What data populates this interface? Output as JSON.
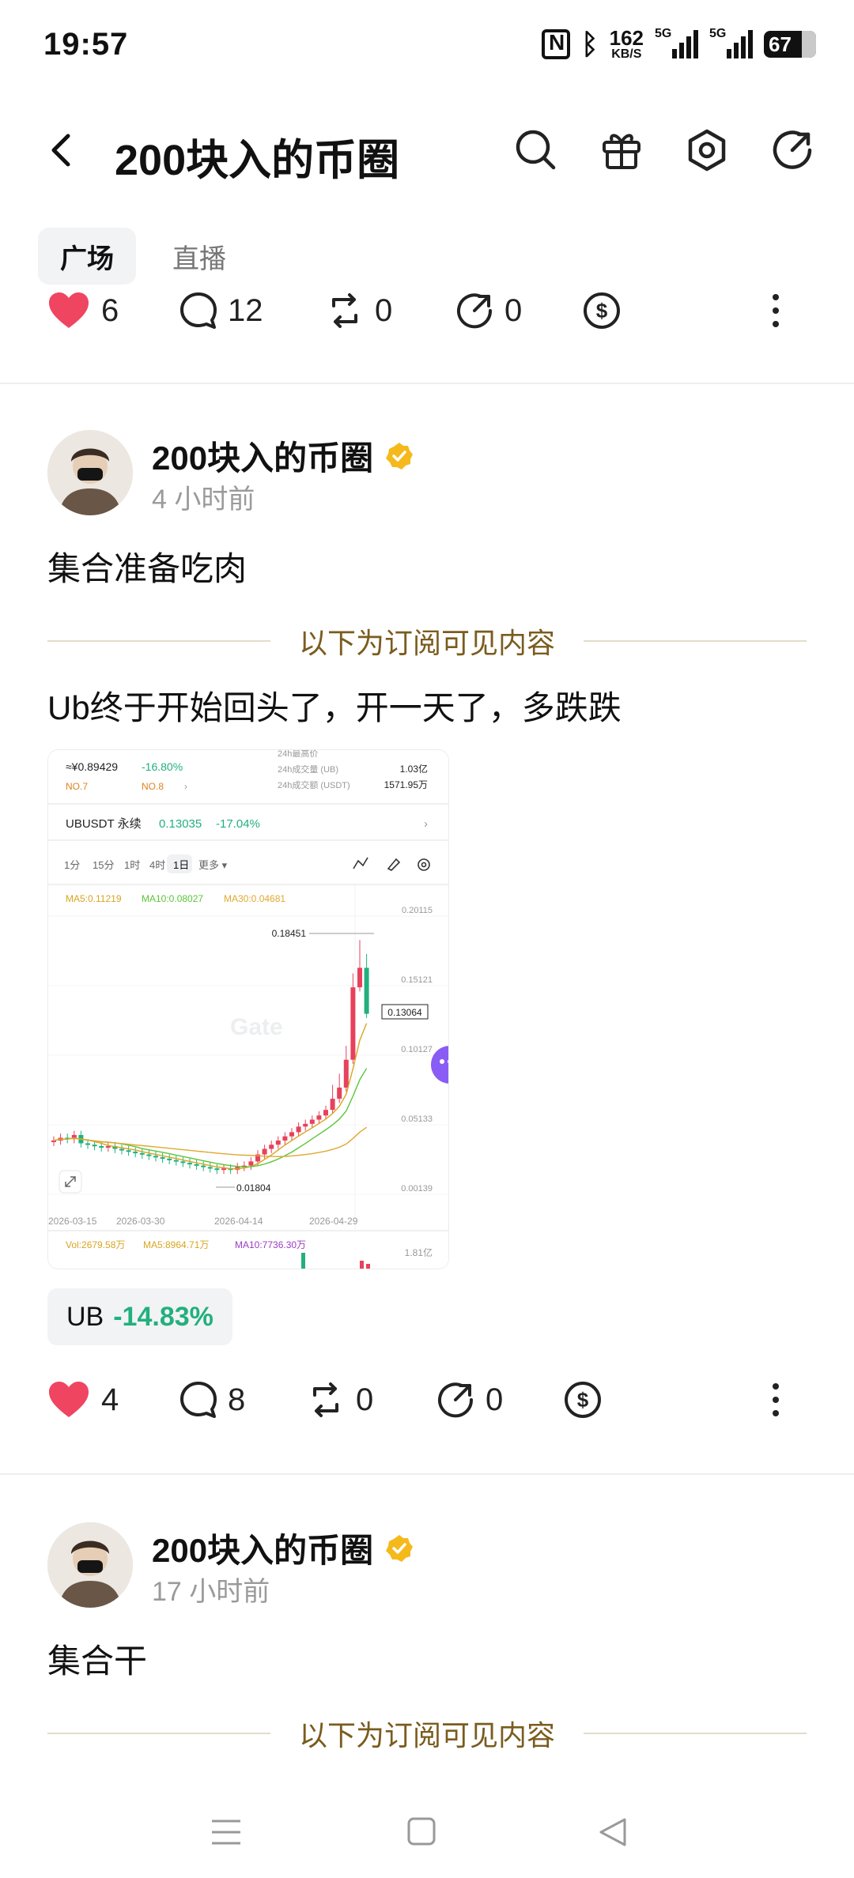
{
  "status": {
    "time": "19:57",
    "speed_value": "162",
    "speed_unit": "KB/S",
    "signal1": "5G",
    "signal2": "5G",
    "battery": "67"
  },
  "header": {
    "title": "200块入的币圈"
  },
  "tabs": [
    {
      "label": "广场"
    },
    {
      "label": "直播"
    }
  ],
  "top_actions": {
    "likes": "6",
    "comments": "12",
    "reposts": "0",
    "shares": "0"
  },
  "posts": [
    {
      "author": "200块入的币圈",
      "time": "4 小时前",
      "text": "集合准备吃肉",
      "subscriber_label": "以下为订阅可见内容",
      "sub_text": "Ub终于开始回头了，开一天了，多跌跌",
      "coin_tag": {
        "symbol": "UB",
        "change": "-14.83%"
      },
      "actions": {
        "likes": "4",
        "comments": "8",
        "reposts": "0",
        "shares": "0"
      }
    },
    {
      "author": "200块入的币圈",
      "time": "17 小时前",
      "text": "集合干",
      "subscriber_label": "以下为订阅可见内容"
    }
  ],
  "chart_image": {
    "price_line": "≈¥0.89429",
    "price_change": "-16.80%",
    "rank1": "NO.7",
    "rank2": "NO.8",
    "stat1_label": "24h成交量 (UB)",
    "stat1_value": "1.03亿",
    "stat2_label": "24h成交额 (USDT)",
    "stat2_value": "1571.95万",
    "pair": "UBUSDT 永续",
    "pair_price": "0.13035",
    "pair_change": "-17.04%",
    "intervals": [
      "1分",
      "15分",
      "1时",
      "4时",
      "1日",
      "更多 ▾"
    ],
    "ma5": "MA5:0.11219",
    "ma10": "MA10:0.08027",
    "ma30": "MA30:0.04681",
    "y_labels": [
      "0.20115",
      "0.15121",
      "0.10127",
      "0.05133",
      "0.00139"
    ],
    "high_label": "0.18451",
    "current_label": "0.13064",
    "low_label": "0.01804",
    "x_labels": [
      "2026-03-15",
      "2026-03-30",
      "2026-04-14",
      "2026-04-29"
    ],
    "watermark": "Gate",
    "vol": "Vol:2679.58万",
    "vol_ma5": "MA5:8964.71万",
    "vol_ma10": "MA10:7736.30万",
    "vol_axis": "1.81亿",
    "colors": {
      "up": "#22b07d",
      "down": "#e8415b",
      "ma5": "#d9a520",
      "ma10": "#5cc43a",
      "ma30": "#e0a830"
    }
  },
  "navbar": {
    "items": [
      "menu",
      "home",
      "back"
    ]
  }
}
